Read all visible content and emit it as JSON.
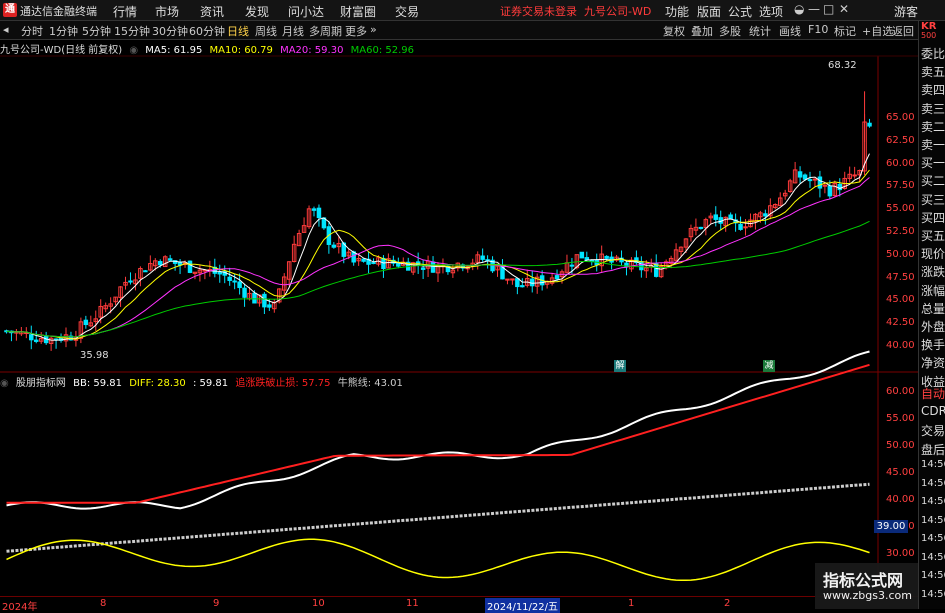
{
  "titlebar": {
    "app_name": "通达信金融终端",
    "menus": [
      "行情",
      "市场",
      "资讯",
      "发现",
      "问小达",
      "财富圈",
      "交易"
    ],
    "warning": "证券交易未登录",
    "stock": "九号公司-WD",
    "right_menus": [
      "功能",
      "版面",
      "公式",
      "选项"
    ],
    "guest": "游客"
  },
  "toolbar": {
    "periods": [
      "分时",
      "1分钟",
      "5分钟",
      "15分钟",
      "30分钟",
      "60分钟",
      "日线",
      "周线",
      "月线",
      "多周期",
      "更多"
    ],
    "active_period": "日线",
    "right_tools": [
      "复权",
      "叠加",
      "多股",
      "统计",
      "画线",
      "F10",
      "标记",
      "+自选",
      "返回"
    ]
  },
  "infoline": {
    "name": "九号公司-WD(日线 前复权)",
    "ma5": "MA5: 61.95",
    "ma10": "MA10: 60.79",
    "ma20": "MA20: 59.30",
    "ma60": "MA60: 52.96"
  },
  "indicator": {
    "name": "股朋指标网",
    "bb": "BB: 59.81",
    "diff": "DIFF: 28.30",
    "val": ": 59.81",
    "stop": "追涨跌破止损: 57.75",
    "bull": "牛熊线: 43.01"
  },
  "sidebar": {
    "top_code": "KR",
    "top_sub": "500",
    "items": [
      "委比",
      "卖五",
      "卖四",
      "卖三",
      "卖二",
      "卖一",
      "买一",
      "买二",
      "买三",
      "买四",
      "买五",
      "现价",
      "涨跌",
      "涨幅",
      "总量",
      "外盘",
      "换手",
      "净资",
      "收益"
    ],
    "items2": [
      "自动",
      "CDR",
      "交易",
      "盘后",
      "14:56",
      "14:56",
      "14:56",
      "14:56",
      "14:56",
      "14:56",
      "14:56",
      "14:56"
    ]
  },
  "price_axis": [
    "65.00",
    "62.50",
    "60.00",
    "57.50",
    "55.00",
    "52.50",
    "50.00",
    "47.50",
    "45.00",
    "42.50",
    "40.00"
  ],
  "ind_axis": [
    "60.00",
    "55.00",
    "50.00",
    "45.00",
    "40.00",
    "35.00",
    "30.00"
  ],
  "ind_tag": "39.00",
  "annotations": {
    "high": "68.32",
    "low": "35.98",
    "mark1": "解",
    "mark2": "减"
  },
  "xaxis": [
    "2024年",
    "8",
    "9",
    "10",
    "11",
    "2024/11/22/五",
    "1",
    "2"
  ],
  "watermark": {
    "title": "指标公式网",
    "url": "www.zbgs3.com"
  },
  "colors": {
    "up": "#ff3b3b",
    "down": "#00e5ff",
    "ma5": "#ffffff",
    "ma10": "#ffff00",
    "ma20": "#ff33ff",
    "ma60": "#00cc00",
    "bb": "#ffffff",
    "stop": "#ff2020",
    "bull": "#cccccc",
    "diff": "#ffff00"
  }
}
